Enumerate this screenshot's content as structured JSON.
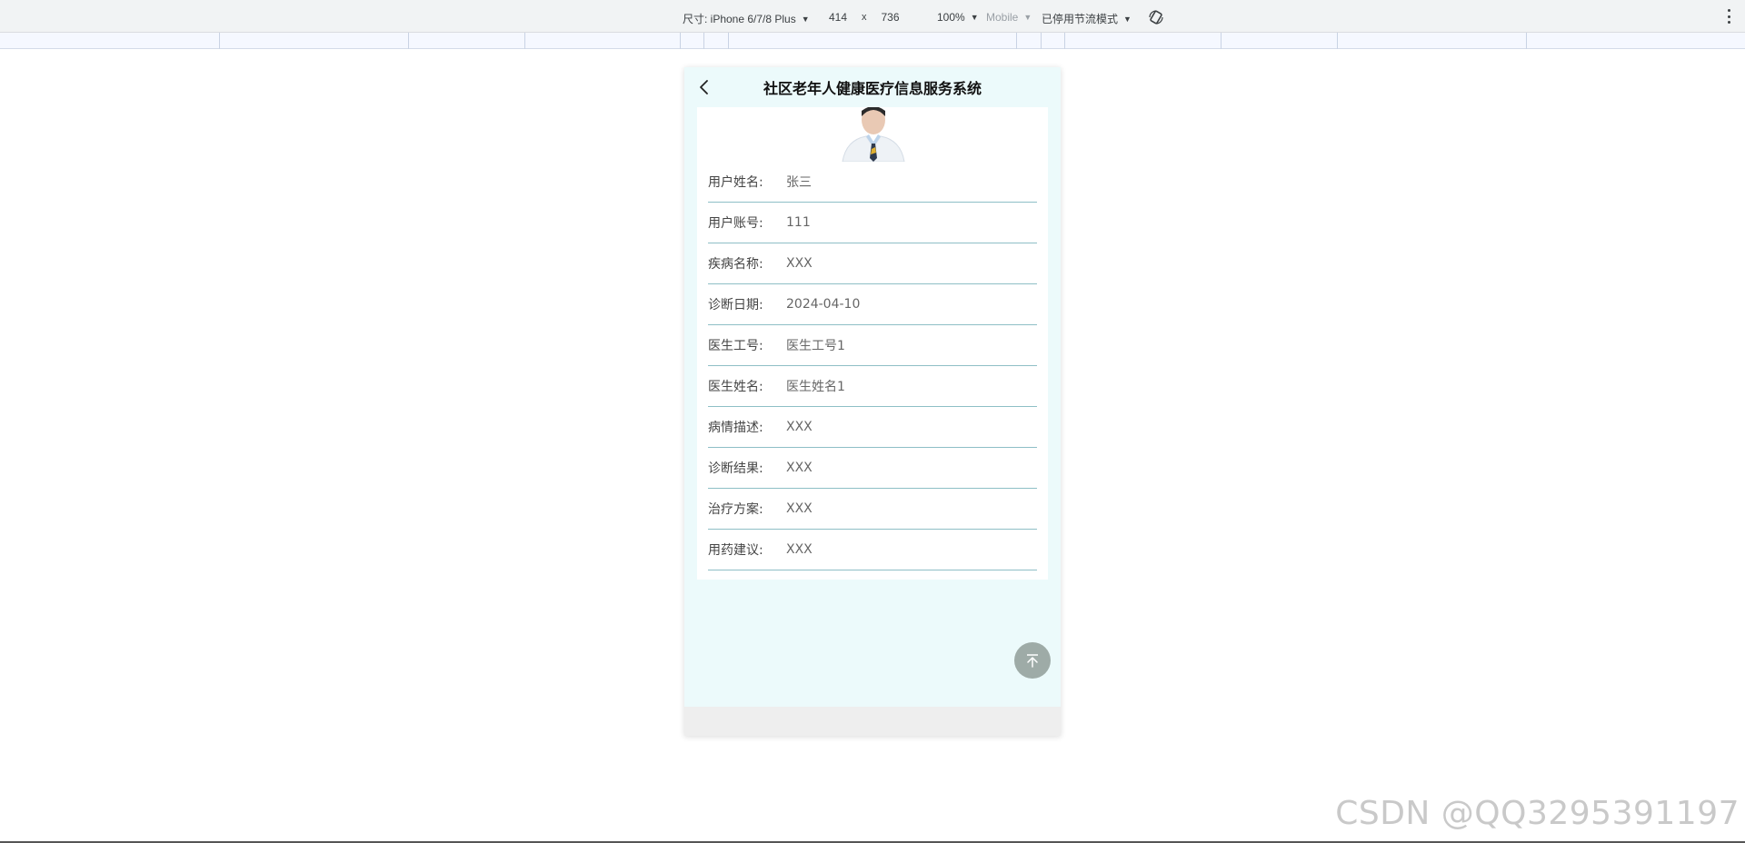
{
  "devtools": {
    "dimensions_label": "尺寸: iPhone 6/7/8 Plus",
    "width": "414",
    "times": "x",
    "height": "736",
    "zoom": "100%",
    "device_type": "Mobile",
    "throttling": "已停用节流模式"
  },
  "app": {
    "title": "社区老年人健康医疗信息服务系统",
    "fields": [
      {
        "label": "用户姓名:",
        "value": "张三"
      },
      {
        "label": "用户账号:",
        "value": "111"
      },
      {
        "label": "疾病名称:",
        "value": "XXX"
      },
      {
        "label": "诊断日期:",
        "value": "2024-04-10"
      },
      {
        "label": "医生工号:",
        "value": "医生工号1"
      },
      {
        "label": "医生姓名:",
        "value": "医生姓名1"
      },
      {
        "label": "病情描述:",
        "value": "XXX"
      },
      {
        "label": "诊断结果:",
        "value": "XXX"
      },
      {
        "label": "治疗方案:",
        "value": "XXX"
      },
      {
        "label": "用药建议:",
        "value": "XXX"
      }
    ]
  },
  "watermark": "CSDN @QQ3295391197",
  "icons": [
    "chevron-down-icon",
    "rotate-icon",
    "kebab-menu-icon",
    "back-arrow-icon",
    "back-to-top-icon"
  ]
}
